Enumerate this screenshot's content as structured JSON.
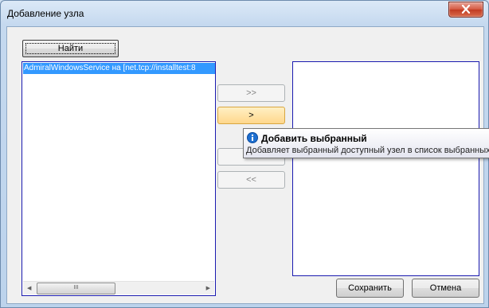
{
  "window": {
    "title": "Добавление узла"
  },
  "toolbar": {
    "find_label": "Найти"
  },
  "available_list": {
    "items": [
      "AdmiralWindowsService на [net.tcp://installtest:8"
    ],
    "scrollbar_grip": "III"
  },
  "transfer_buttons": {
    "add_all": ">>",
    "add_selected": ">",
    "remove_selected": "",
    "remove_all": "<<"
  },
  "tooltip": {
    "title": "Добавить выбранный",
    "text": "Добавляет выбранный доступный узел в список выбранных"
  },
  "footer": {
    "save_label": "Сохранить",
    "cancel_label": "Отмена"
  },
  "colors": {
    "selection": "#3399ff",
    "list_border": "#1b1bb0",
    "close_button": "#c13b22",
    "hover_button": "#ffd78c"
  },
  "icons": {
    "close": "close-icon",
    "info": "info-icon"
  }
}
